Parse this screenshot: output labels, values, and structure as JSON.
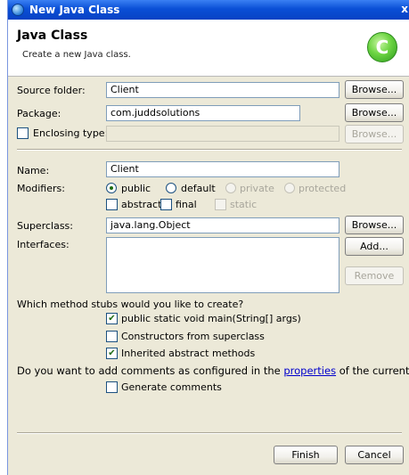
{
  "window": {
    "title": "New Java Class"
  },
  "banner": {
    "title": "Java Class",
    "description": "Create a new Java class."
  },
  "source_folder": {
    "label": "Source folder:",
    "value": "Client",
    "browse_label": "Browse..."
  },
  "package": {
    "label": "Package:",
    "value": "com.juddsolutions",
    "browse_label": "Browse..."
  },
  "enclosing_type": {
    "label": "Enclosing type:",
    "checked": false,
    "value": "",
    "browse_label": "Browse..."
  },
  "name": {
    "label": "Name:",
    "value": "Client"
  },
  "modifiers": {
    "label": "Modifiers:",
    "visibility": [
      {
        "label": "public",
        "selected": true,
        "enabled": true
      },
      {
        "label": "default",
        "selected": false,
        "enabled": true
      },
      {
        "label": "private",
        "selected": false,
        "enabled": false
      },
      {
        "label": "protected",
        "selected": false,
        "enabled": false
      }
    ],
    "flags": [
      {
        "label": "abstract",
        "checked": false,
        "enabled": true
      },
      {
        "label": "final",
        "checked": false,
        "enabled": true
      },
      {
        "label": "static",
        "checked": false,
        "enabled": false
      }
    ]
  },
  "superclass": {
    "label": "Superclass:",
    "value": "java.lang.Object",
    "browse_label": "Browse..."
  },
  "interfaces": {
    "label": "Interfaces:",
    "add_label": "Add...",
    "remove_label": "Remove"
  },
  "stubs": {
    "question": "Which method stubs would you like to create?",
    "options": [
      {
        "label": "public static void main(String[] args)",
        "checked": true
      },
      {
        "label": "Constructors from superclass",
        "checked": false
      },
      {
        "label": "Inherited abstract methods",
        "checked": true
      }
    ]
  },
  "comments": {
    "question_prefix": "Do you want to add comments as configured in the",
    "link_text": "properties",
    "question_suffix": "of the current project?",
    "option_label": "Generate comments",
    "checked": false
  },
  "footer": {
    "finish_label": "Finish",
    "cancel_label": "Cancel"
  },
  "check_glyph": "✔",
  "close_glyph": "x",
  "logo_glyph": "C"
}
